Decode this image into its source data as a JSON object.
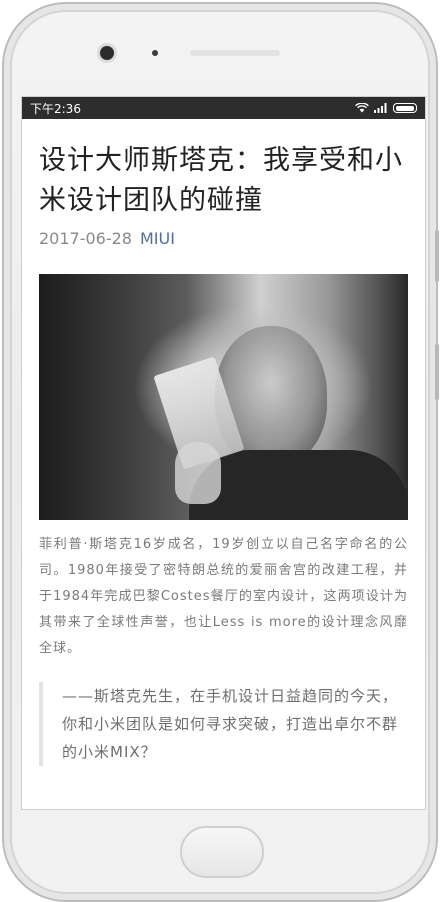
{
  "status_bar": {
    "time": "下午2:36"
  },
  "article": {
    "title": "设计大师斯塔克：我享受和小米设计团队的碰撞",
    "date": "2017-06-28",
    "author": "MIUI",
    "image_caption": "菲利普·斯塔克16岁成名，19岁创立以自己名字命名的公司。1980年接受了密特朗总统的爱丽舍宫的改建工程，并于1984年完成巴黎Costes餐厅的室内设计，这两项设计为其带来了全球性声誉，也让Less is more的设计理念风靡全球。",
    "quote": "——斯塔克先生，在手机设计日益趋同的今天，你和小米团队是如何寻求突破，打造出卓尔不群的小米MIX？"
  },
  "colors": {
    "status_bar_bg": "#2d2d2d",
    "title": "#222222",
    "author_link": "#4f6f99",
    "body_text": "#7a7a7a"
  }
}
